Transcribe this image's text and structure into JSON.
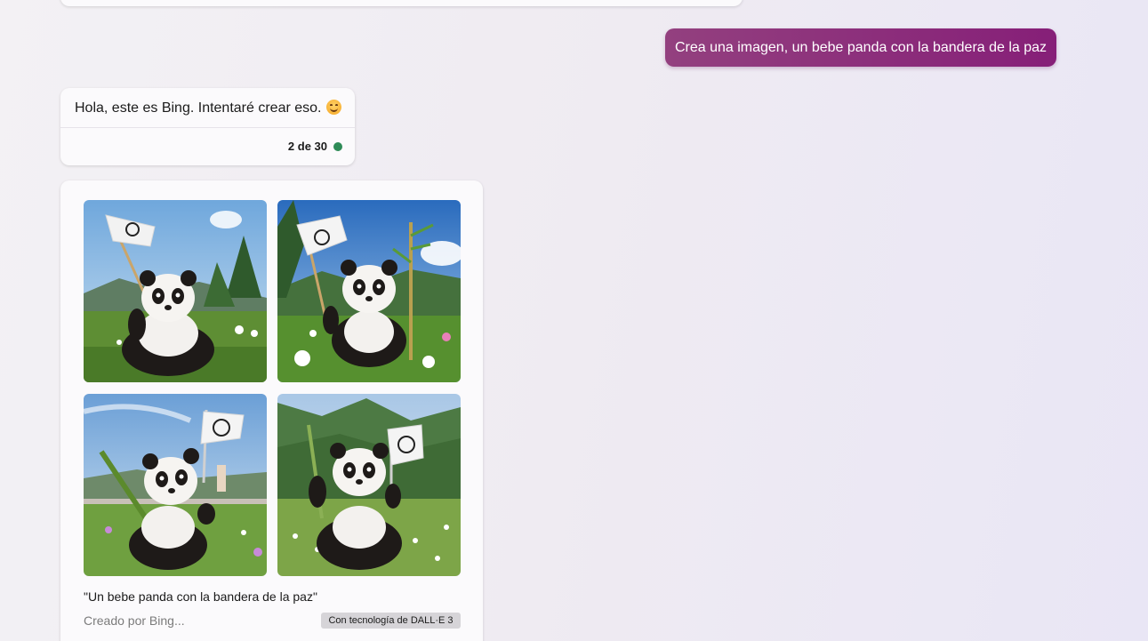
{
  "user_message": {
    "text": "Crea una imagen, un bebe panda con la bandera de la paz"
  },
  "bot_message": {
    "text": "Hola, este es Bing. Intentaré crear eso.",
    "emoji": "smiling-face-emoji",
    "counter": "2 de 30",
    "status_color": "#2e8b57"
  },
  "image_result": {
    "images": [
      {
        "icon": "panda-peace-flag-image-1"
      },
      {
        "icon": "panda-peace-flag-image-2"
      },
      {
        "icon": "panda-peace-flag-image-3"
      },
      {
        "icon": "panda-peace-flag-image-4"
      }
    ],
    "caption": "\"Un bebe panda con la bandera de la paz\"",
    "creator": "Creado por Bing...",
    "badge": "Con tecnología de DALL·E 3"
  },
  "colors": {
    "user_bubble_start": "#93407f",
    "user_bubble_end": "#861f78",
    "card_bg": "#fbfafc"
  }
}
